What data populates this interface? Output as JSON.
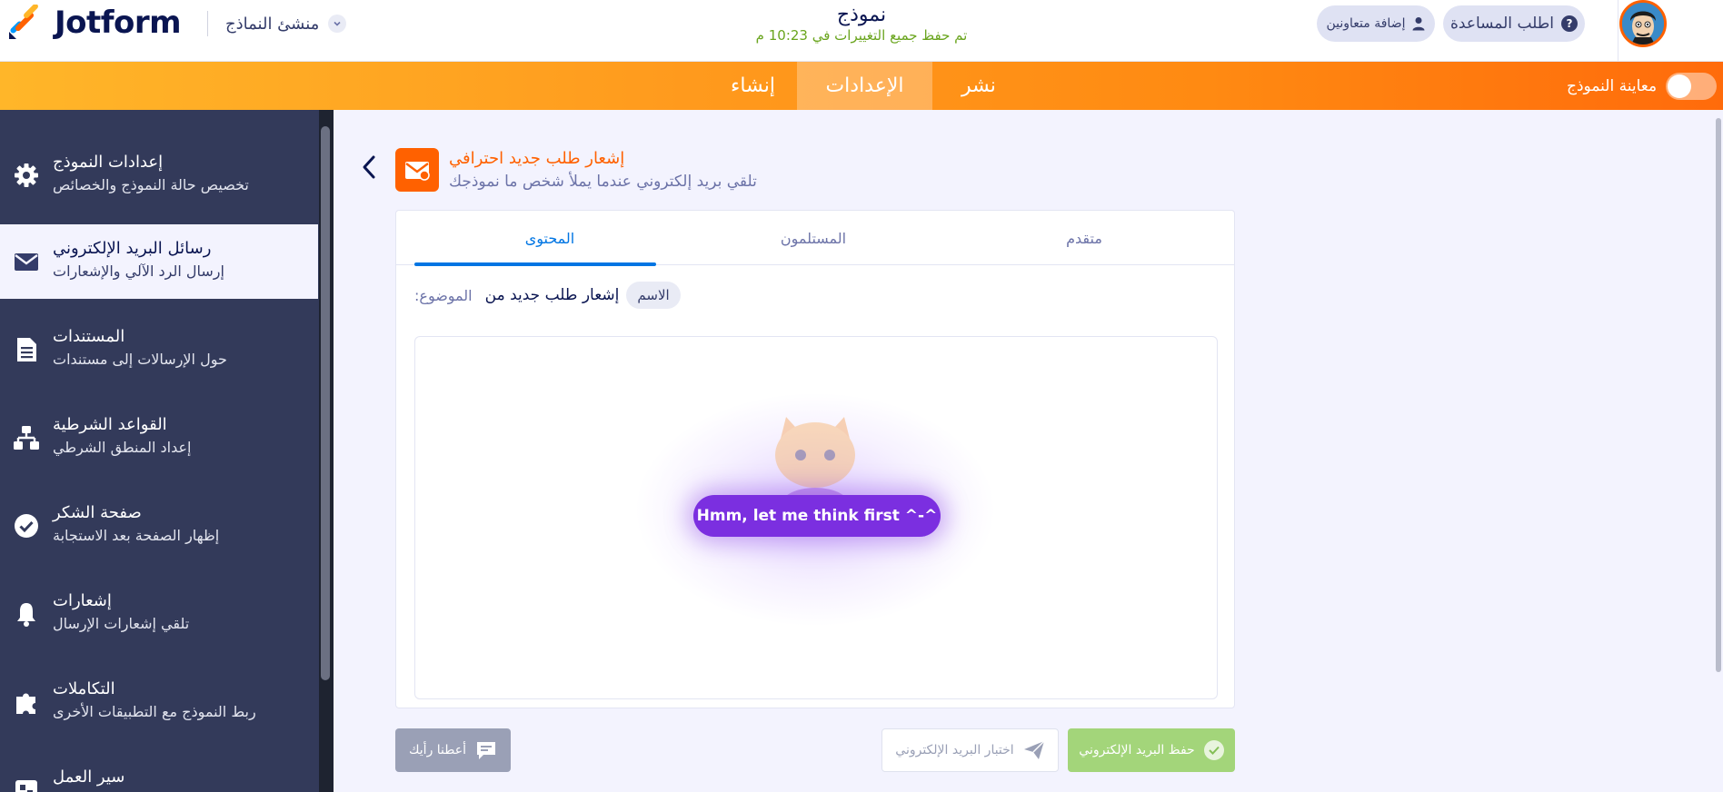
{
  "header": {
    "brand": "Jotform",
    "builder_menu_label": "منشئ النماذج",
    "form_title": "نموذج",
    "save_status": "تم حفظ جميع التغييرات في 10:23 م",
    "help_button": "اطلب المساعدة",
    "help_glyph": "?",
    "collaborators_button": "إضافة متعاونين"
  },
  "nav": {
    "tabs": [
      {
        "label": "إنشاء"
      },
      {
        "label": "الإعدادات",
        "active": true
      },
      {
        "label": "نشر"
      }
    ],
    "preview_label": "معاينة النموذج",
    "preview_enabled": false
  },
  "sidebar": {
    "items": [
      {
        "title": "إعدادات النموذج",
        "desc": "تخصيص حالة النموذج والخصائص",
        "icon": "gear-icon"
      },
      {
        "title": "رسائل البريد الإلكتروني",
        "desc": "إرسال الرد الآلي والإشعارات",
        "icon": "envelope-icon",
        "active": true
      },
      {
        "title": "المستندات",
        "desc": "حول الإرسالات إلى مستندات",
        "icon": "document-icon"
      },
      {
        "title": "القواعد الشرطية",
        "desc": "إعداد المنطق الشرطي",
        "icon": "sitemap-icon"
      },
      {
        "title": "صفحة الشكر",
        "desc": "إظهار الصفحة بعد الاستجابة",
        "icon": "check-circle-icon"
      },
      {
        "title": "إشعارات",
        "desc": "تلقي إشعارات الإرسال",
        "icon": "bell-icon"
      },
      {
        "title": "التكاملات",
        "desc": "ربط النموذج مع التطبيقات الأخرى",
        "icon": "puzzle-icon"
      },
      {
        "title": "سير العمل",
        "desc": "",
        "icon": "workflow-icon"
      }
    ]
  },
  "notification": {
    "title": "إشعار طلب جديد احترافي",
    "subtitle": "تلقي بريد إلكتروني عندما يملأ شخص ما نموذجك",
    "tabs": {
      "content": "المحتوى",
      "recipients": "المستلمون",
      "advanced": "متقدم"
    },
    "subject_label": ":الموضوع",
    "subject_text": "إشعار طلب جديد من",
    "subject_tag": "الاسم",
    "loading_message": "Hmm, let me think first ^-^"
  },
  "actions": {
    "feedback": "أعطنا رأيك",
    "test_email": "اختبار البريد الإلكتروني",
    "save_email": "حفظ البريد الإلكتروني"
  },
  "colors": {
    "brand_orange": "#ff6100",
    "nav_gradient_start": "#ffb629",
    "nav_gradient_end": "#ff6b0b",
    "sidebar_bg": "#333a5a",
    "active_tab_blue": "#0075e3",
    "save_green": "#a3d57a",
    "think_purple": "#7b2fe0",
    "status_green": "#6aa51e"
  }
}
